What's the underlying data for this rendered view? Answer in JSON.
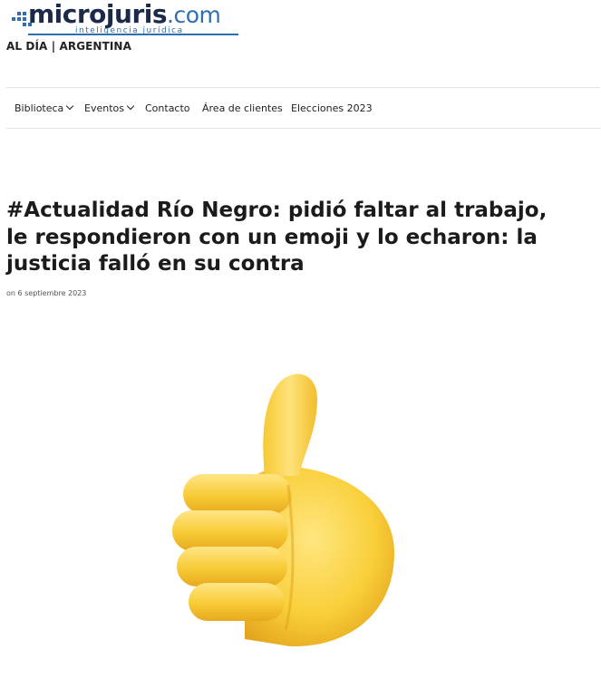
{
  "brand": {
    "logo_main": "microjuris",
    "logo_suffix": ".com",
    "logo_tagline": "inteligencia jurídica",
    "accent_color": "#2f6fb1",
    "dark_color": "#1c2a4a"
  },
  "header": {
    "tagline": "AL DÍA | ARGENTINA"
  },
  "nav": {
    "items": [
      {
        "label": "Biblioteca",
        "has_dropdown": true
      },
      {
        "label": "Eventos",
        "has_dropdown": true
      },
      {
        "label": "Contacto",
        "has_dropdown": false
      },
      {
        "label": "Área de clientes",
        "has_dropdown": false
      },
      {
        "label": "Elecciones 2023",
        "has_dropdown": false
      }
    ]
  },
  "article": {
    "title": "#Actualidad Río Negro: pidió faltar al trabajo, le respondieron con un emoji y lo echaron: la justicia falló en su contra",
    "date": "on 6 septiembre 2023",
    "image_icon": "thumbs-up-emoji-icon"
  }
}
